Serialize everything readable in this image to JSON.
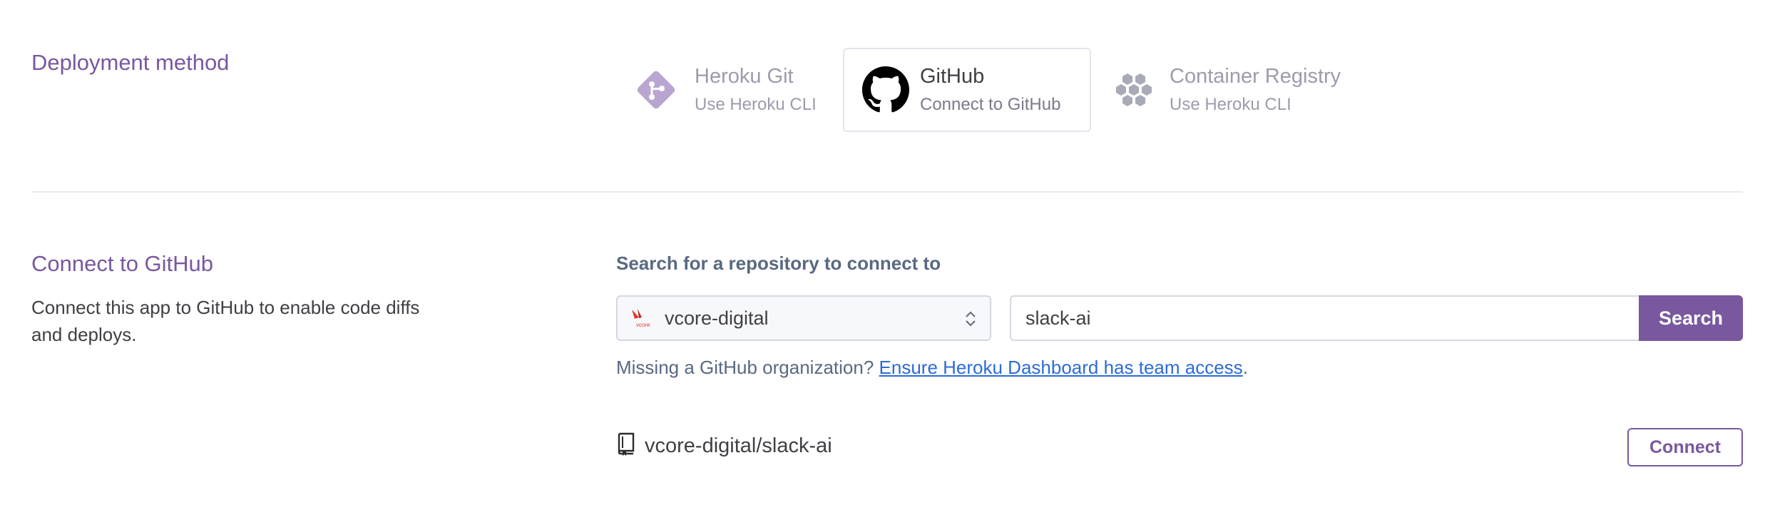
{
  "deployment": {
    "title": "Deployment method",
    "methods": [
      {
        "name": "Heroku Git",
        "sub": "Use Heroku CLI",
        "icon": "heroku-git-icon",
        "selected": false
      },
      {
        "name": "GitHub",
        "sub": "Connect to GitHub",
        "icon": "github-icon",
        "selected": true
      },
      {
        "name": "Container Registry",
        "sub": "Use Heroku CLI",
        "icon": "container-registry-icon",
        "selected": false
      }
    ]
  },
  "connect": {
    "title": "Connect to GitHub",
    "description": "Connect this app to GitHub to enable code diffs and deploys.",
    "search_label": "Search for a repository to connect to",
    "owner_value": "vcore-digital",
    "owner_logo_text": "vcore",
    "repo_input_value": "slack-ai",
    "search_button": "Search",
    "missing_text": "Missing a GitHub organization? ",
    "missing_link": "Ensure Heroku Dashboard has team access",
    "missing_after": ".",
    "result_repo": "vcore-digital/slack-ai",
    "connect_button": "Connect"
  },
  "colors": {
    "accent": "#79589f",
    "link": "#2c6cd5",
    "muted": "#9c9cad"
  }
}
